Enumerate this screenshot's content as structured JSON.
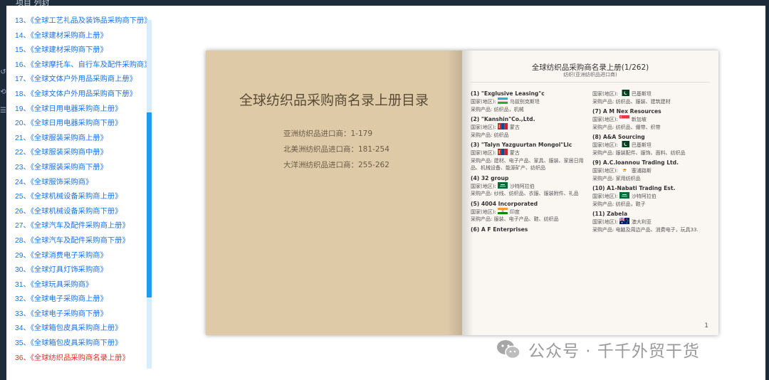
{
  "toc_list": [
    "13、《全球工艺礼品及装饰品采购商下册》",
    "14、《全球建材采购商上册》",
    "15、《全球建材采购商下册》",
    "16、《全球摩托车、自行车及配件采购商》",
    "17、《全球文体户外用品采购商上册》",
    "18、《全球文体户外用品采购商下册》",
    "19、《全球日用电器采购商上册》",
    "20、《全球日用电器采购商下册》",
    "21、《全球服装采购商上册》",
    "22、《全球服装采购商中册》",
    "23、《全球服装采购商下册》",
    "24、《全球服饰采购商》",
    "25、《全球机械设备采购商上册》",
    "26、《全球机械设备采购商下册》",
    "27、《全球汽车及配件采购商上册》",
    "28、《全球汽车及配件采购商下册》",
    "29、《全球消费电子采购商》",
    "30、《全球灯具灯饰采购商》",
    "31、《全球玩具采购商》",
    "32、《全球电子采购商上册》",
    "33、《全球电子采购商下册》",
    "34、《全球箱包皮具采购商上册》",
    "35、《全球箱包皮具采购商下册》",
    "36、《全球纺织品采购商名录上册》"
  ],
  "toc_active_index": 23,
  "colors": {
    "link": "#1a73e8",
    "active": "#e8302b",
    "scroll_thumb": "#1e9bea"
  },
  "left_page": {
    "title": "全球纺织品采购商名录上册目录",
    "entries": [
      "亚洲纺织品进口商：1-179",
      "北美洲纺织品进口商：181-254",
      "大洋洲纺织品进口商：255-262"
    ]
  },
  "right_page": {
    "title": "全球纺织品采购商名录上册(1/262)",
    "subtitle": "纺织(亚洲纺织品进口商)",
    "page_number": "1",
    "col1": [
      {
        "name": "(1) \"Exglusive Leasing\"c",
        "country_label": "国家(地区):",
        "flag": "uzbekistan",
        "country": "乌兹别克斯坦",
        "products": "采购产品: 纺织品，机械"
      },
      {
        "name": "(2) \"Kanshin\"Co.,Ltd.",
        "country_label": "国家(地区):",
        "flag": "mongolia",
        "country": "蒙古",
        "products": "采购产品: 纺织品"
      },
      {
        "name": "(3) \"Talyn Yazguurtan Mongol\"Llc",
        "country_label": "国家(地区):",
        "flag": "mongolia",
        "country": "蒙古",
        "products": "采购产品: 建材、电子产品、家具、服装、家居日用品、机械设备、能源矿产、纺织品"
      },
      {
        "name": "(4) 32 group",
        "country_label": "国家(地区):",
        "flag": "saudi",
        "country": "沙特阿拉伯",
        "products": "采购产品: 纱线、纺织品、衣服、服装附件、礼品"
      },
      {
        "name": "(5) 4004 Incorporated",
        "country_label": "国家(地区):",
        "flag": "india",
        "country": "印度",
        "products": "采购产品: 服装、电子产品、鞋、纺织品"
      },
      {
        "name": "(6) A F Enterprises",
        "country_label": "",
        "flag": "",
        "country": "",
        "products": ""
      }
    ],
    "col2": [
      {
        "name": "",
        "country_label": "国家(地区):",
        "flag": "pakistan",
        "country": "巴基斯坦",
        "products": "采购产品: 纺织品、服装、建筑建材"
      },
      {
        "name": "(7) A M Nex Resources",
        "country_label": "国家(地区):",
        "flag": "singapore",
        "country": "新加坡",
        "products": "采购产品: 纺织品、绷带、织带"
      },
      {
        "name": "(8) A&A Sourcing",
        "country_label": "国家(地区):",
        "flag": "pakistan",
        "country": "巴基斯坦",
        "products": "采购产品: 服装配件、服饰、面料、纺织品"
      },
      {
        "name": "(9) A.C.Ioannou Trading Ltd.",
        "country_label": "国家(地区):",
        "flag": "cyprus",
        "country": "塞浦路斯",
        "products": "采购产品: 家用纺织品"
      },
      {
        "name": "(10) A1-Nabati Trading Est.",
        "country_label": "国家(地区):",
        "flag": "saudi",
        "country": "沙特阿拉伯",
        "products": "采购产品: 纺织品，鞋子"
      },
      {
        "name": "(11) Zabela",
        "country_label": "国家(地区):",
        "flag": "australia",
        "country": "澳大利亚",
        "products": "采购产品: 电脑及周边产品、消费电子，玩具33."
      }
    ]
  },
  "watermark": {
    "text": "公众号 · 千千外贸干货",
    "icon": "wechat-icon"
  },
  "top_bar_ghost_text": "项目 列封"
}
